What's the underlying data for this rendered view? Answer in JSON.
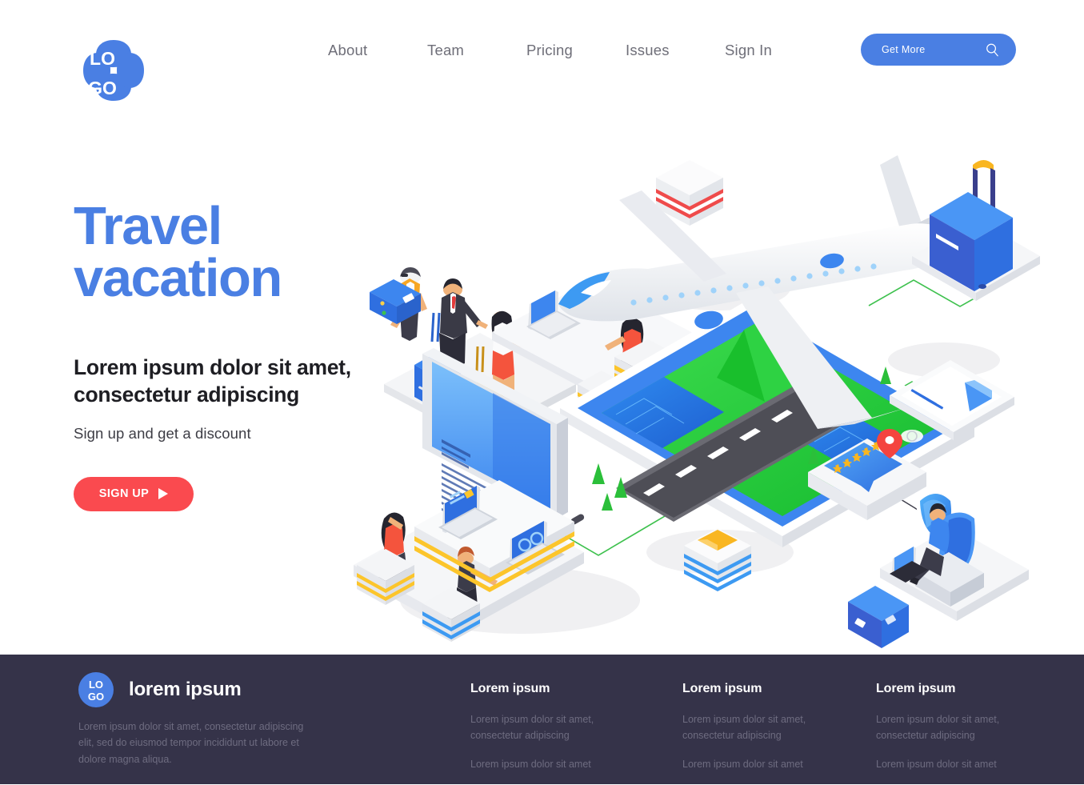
{
  "header": {
    "logo": {
      "line1": "LO",
      "line2": "GO",
      "name": "logo"
    },
    "nav": [
      {
        "label": "About"
      },
      {
        "label": "Team"
      },
      {
        "label": "Pricing"
      },
      {
        "label": "Issues"
      },
      {
        "label": "Sign In"
      }
    ],
    "cta": {
      "label": "Get More",
      "icon": "search-icon"
    }
  },
  "hero": {
    "title_line1": "Travel",
    "title_line2": "vacation",
    "subtitle": "Lorem ipsum dolor sit amet, consectetur adipiscing",
    "note": "Sign up and get a discount",
    "button": {
      "label": "SIGN UP",
      "icon": "play-icon"
    }
  },
  "illustration": {
    "name": "isometric-travel-scene",
    "elements": [
      "traveler-with-yellow-vest",
      "businessman-with-suitcase",
      "woman-traveler",
      "blue-suitcase",
      "yellow-suitcase",
      "check-in-desk-with-laptop",
      "seated-agent",
      "red-striped-stack",
      "blue-striped-stack-with-envelope",
      "airplane",
      "runway-on-tablet",
      "green-landscape",
      "blue-water",
      "rolling-suitcase",
      "five-star-review-card",
      "location-pin",
      "document-card",
      "passenger-in-airplane-seat",
      "blue-briefcase",
      "large-blue-monitor",
      "workstation-dashboards",
      "two-workers"
    ]
  },
  "colors": {
    "brand_blue": "#4a7fe3",
    "accent_red": "#fa4a4f",
    "footer_bg": "#353349",
    "green": "#3ec14e",
    "yellow": "#f9b621",
    "nav_text": "#6e6e78"
  },
  "footer": {
    "logo": {
      "line1": "LO",
      "line2": "GO"
    },
    "brand_name": "lorem ipsum",
    "description": "Lorem ipsum dolor sit amet, consectetur adipiscing elit, sed do eiusmod tempor incididunt ut labore et dolore magna aliqua.",
    "columns": [
      {
        "title": "Lorem ipsum",
        "links": [
          "Lorem ipsum dolor sit amet, consectetur adipiscing",
          "Lorem ipsum dolor sit amet"
        ]
      },
      {
        "title": "Lorem ipsum",
        "links": [
          "Lorem ipsum dolor sit amet, consectetur adipiscing",
          "Lorem ipsum dolor sit amet"
        ]
      },
      {
        "title": "Lorem ipsum",
        "links": [
          "Lorem ipsum dolor sit amet, consectetur adipiscing",
          "Lorem ipsum dolor sit amet"
        ]
      }
    ]
  }
}
